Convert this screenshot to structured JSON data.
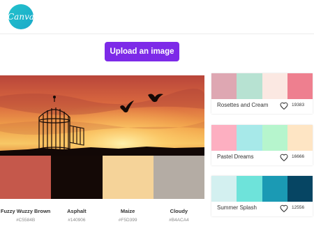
{
  "app": {
    "logo_text": "Canva"
  },
  "upload_button": {
    "label": "Upload an image"
  },
  "image_palette": {
    "colors": [
      {
        "name": "Fuzzy Wuzzy Brown",
        "hex": "#C5584B"
      },
      {
        "name": "Asphalt",
        "hex": "#140906"
      },
      {
        "name": "Maize",
        "hex": "#F5D399"
      },
      {
        "name": "Cloudy",
        "hex": "#B4ACA4"
      }
    ]
  },
  "palettes": [
    {
      "name": "Rosettes and Cream",
      "likes": "19383",
      "colors": [
        "#DEA7B2",
        "#B7E2D2",
        "#FBE8E2",
        "#EE7F8F"
      ]
    },
    {
      "name": "Pastel Dreams",
      "likes": "16666",
      "colors": [
        "#FDAFC1",
        "#A7E9E9",
        "#B6F5CD",
        "#FEE5C4"
      ]
    },
    {
      "name": "Summer Splash",
      "likes": "12556",
      "colors": [
        "#D3F0F0",
        "#6EE3DA",
        "#1B9AB4",
        "#064563"
      ]
    }
  ]
}
